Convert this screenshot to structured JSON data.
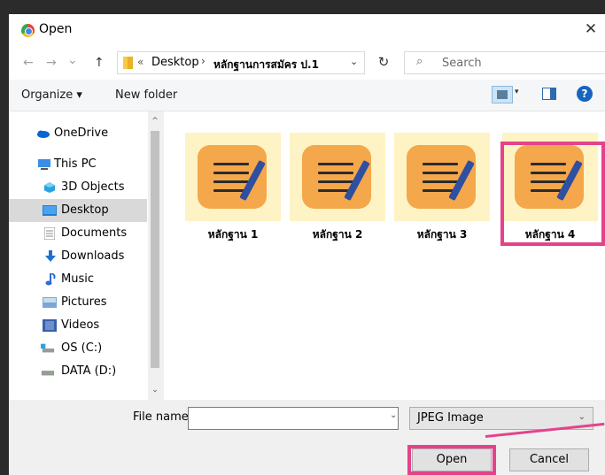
{
  "window": {
    "title": "Open",
    "close_icon": "✕"
  },
  "nav": {
    "back_icon": "←",
    "forward_icon": "→",
    "recent_icon": "⌄",
    "up_icon": "↑",
    "breadcrumb_prefix": "«",
    "breadcrumbs": [
      "Desktop",
      "หลักฐานการสมัคร ป.1"
    ],
    "breadcrumb_sep": "›",
    "address_drop_icon": "⌄",
    "refresh_icon": "↻",
    "search_icon": "⌕",
    "search_placeholder": "Search"
  },
  "toolbar": {
    "organize_label": "Organize ▾",
    "new_folder_label": "New folder",
    "view_drop_icon": "▾",
    "help_icon": "?"
  },
  "sidebar": {
    "scroll_up_icon": "^",
    "scroll_down_icon": "⌄",
    "items": [
      {
        "label": "OneDrive",
        "icon": "cloud-icon",
        "color": "#0a64d2"
      },
      {
        "label": "This PC",
        "icon": "computer-icon",
        "color": "#3a8ee6"
      },
      {
        "label": "3D Objects",
        "icon": "cube-icon",
        "color": "#2aa3e0"
      },
      {
        "label": "Desktop",
        "icon": "desktop-icon",
        "color": "#1f7fd6"
      },
      {
        "label": "Documents",
        "icon": "document-icon",
        "color": "#8a8a8a"
      },
      {
        "label": "Downloads",
        "icon": "download-icon",
        "color": "#1f6fcf"
      },
      {
        "label": "Music",
        "icon": "music-icon",
        "color": "#2d6bd1"
      },
      {
        "label": "Pictures",
        "icon": "pictures-icon",
        "color": "#7aa6d8"
      },
      {
        "label": "Videos",
        "icon": "videos-icon",
        "color": "#3a5fa8"
      },
      {
        "label": "OS (C:)",
        "icon": "drive-os-icon",
        "color": "#2aa3e0"
      },
      {
        "label": "DATA (D:)",
        "icon": "drive-icon",
        "color": "#9a9a9a"
      }
    ]
  },
  "files": [
    {
      "label": "หลักฐาน 1"
    },
    {
      "label": "หลักฐาน 2"
    },
    {
      "label": "หลักฐาน 3"
    },
    {
      "label": "หลักฐาน 4"
    }
  ],
  "bottom": {
    "file_name_label": "File name:",
    "file_name_value": "",
    "file_name_drop_icon": "⌄",
    "file_type_value": "JPEG Image",
    "file_type_drop_icon": "⌄",
    "open_label": "Open",
    "cancel_label": "Cancel"
  },
  "colors": {
    "highlight": "#e4438a",
    "selected": "#d9d9d9",
    "thumb_bg": "#fef3c4",
    "note": "#f5a74b",
    "pen": "#2f4fa0"
  }
}
